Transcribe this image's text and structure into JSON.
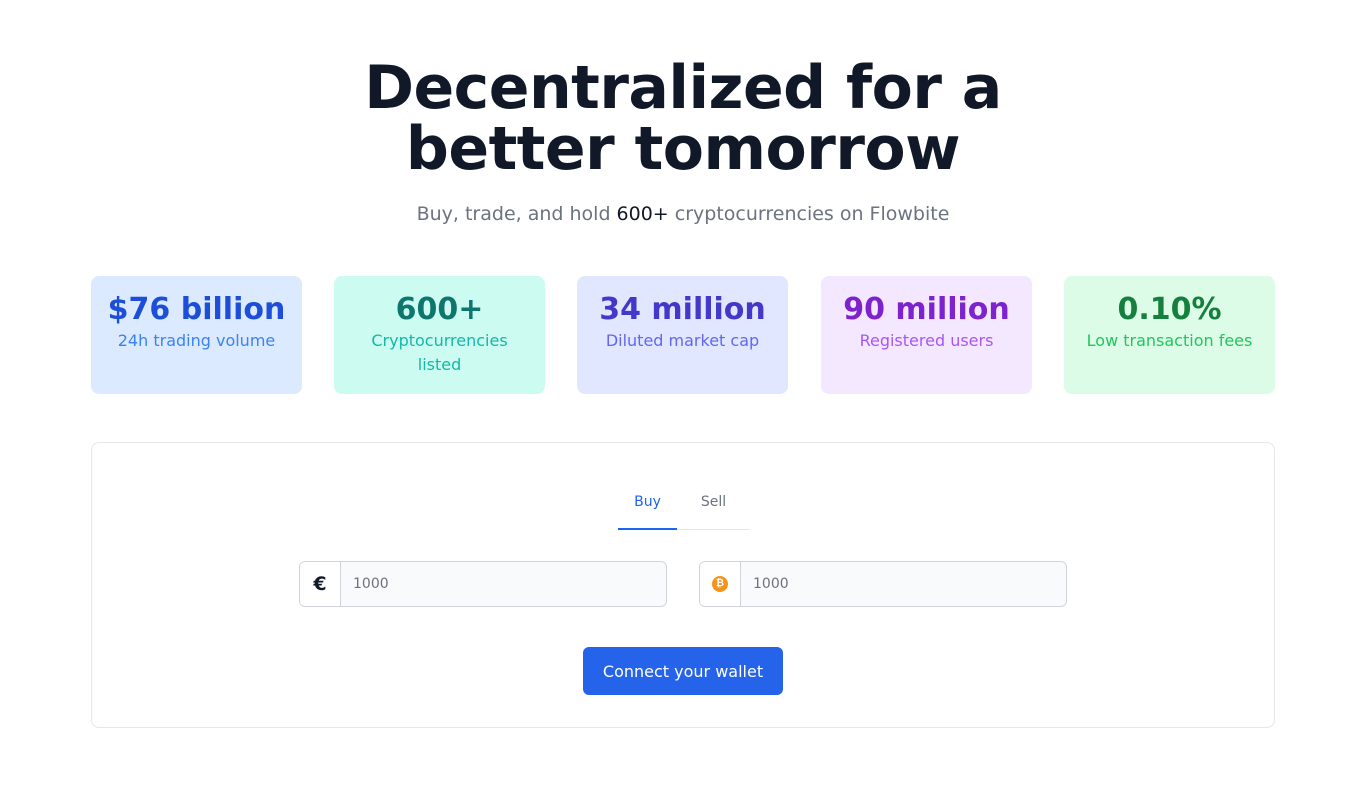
{
  "hero": {
    "title_line1": "Decentralized for a",
    "title_line2": "better tomorrow",
    "subtitle_before": "Buy, trade, and hold ",
    "subtitle_highlight": "600+",
    "subtitle_after": " cryptocurrencies on Flowbite"
  },
  "stats": [
    {
      "value": "$76 billion",
      "label": "24h trading volume",
      "color": "#1d4ed8"
    },
    {
      "value": "600+",
      "label": "Cryptocurrencies listed",
      "color": "#0f766e"
    },
    {
      "value": "34 million",
      "label": "Diluted market cap",
      "color": "#4338ca"
    },
    {
      "value": "90 million",
      "label": "Registered users",
      "color": "#7e22ce"
    },
    {
      "value": "0.10%",
      "label": "Low transaction fees",
      "color": "#15803d"
    }
  ],
  "trade": {
    "tabs": [
      {
        "label": "Buy",
        "active": true
      },
      {
        "label": "Sell",
        "active": false
      }
    ],
    "fiat_symbol": "€",
    "fiat_icon": "euro-icon",
    "fiat_value": "1000",
    "crypto_symbol": "₿",
    "crypto_icon": "bitcoin-icon",
    "crypto_value": "1000",
    "cta_label": "Connect your wallet"
  },
  "colors": {
    "accent": "#2563eb",
    "title": "#111827"
  }
}
